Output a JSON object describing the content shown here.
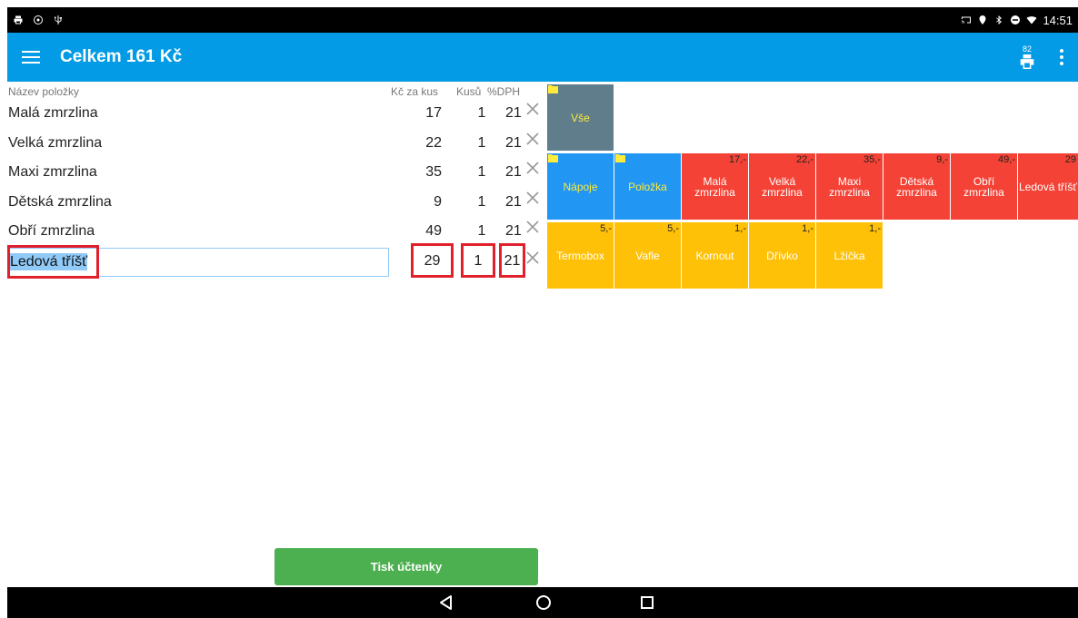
{
  "status_bar": {
    "time": "14:51",
    "left_icons": [
      "print-icon",
      "location-shield-icon",
      "usb-icon"
    ],
    "right_icons": [
      "cast-icon",
      "location-icon",
      "bluetooth-icon",
      "do-not-disturb-icon",
      "wifi-icon"
    ]
  },
  "app_bar": {
    "title": "Celkem 161 Kč",
    "print_badge": "82",
    "background": "#039be5"
  },
  "table": {
    "headers": {
      "name": "Název položky",
      "price": "Kč za kus",
      "qty": "Kusů",
      "vat": "%DPH"
    },
    "rows": [
      {
        "name": "Malá zmrzlina",
        "price": "17",
        "qty": "1",
        "vat": "21"
      },
      {
        "name": "Velká zmrzlina",
        "price": "22",
        "qty": "1",
        "vat": "21"
      },
      {
        "name": "Maxi zmrzlina",
        "price": "35",
        "qty": "1",
        "vat": "21"
      },
      {
        "name": "Dětská zmrzlina",
        "price": "9",
        "qty": "1",
        "vat": "21"
      },
      {
        "name": "Obří zmrzlina",
        "price": "49",
        "qty": "1",
        "vat": "21"
      }
    ],
    "editing": {
      "name": "Ledová tříšť",
      "price": "29",
      "qty": "1",
      "vat": "21"
    }
  },
  "tiles": {
    "all": {
      "label": "Vše",
      "color": "#607d8b"
    },
    "folders": [
      {
        "label": "Nápoje",
        "color": "#2196f3"
      },
      {
        "label": "Položka",
        "color": "#2196f3"
      }
    ],
    "red": [
      {
        "label": "Malá zmrzlina",
        "price": "17,-"
      },
      {
        "label": "Velká zmrzlina",
        "price": "22,-"
      },
      {
        "label": "Maxi zmrzlina",
        "price": "35,-"
      },
      {
        "label": "Dětská zmrzlina",
        "price": "9,-"
      },
      {
        "label": "Obří zmrzlina",
        "price": "49,-"
      },
      {
        "label": "Ledová tříšť",
        "price": "29"
      }
    ],
    "yellow": [
      {
        "label": "Termobox",
        "price": "5,-"
      },
      {
        "label": "Vafle",
        "price": "5,-"
      },
      {
        "label": "Kornout",
        "price": "1,-"
      },
      {
        "label": "Dřívko",
        "price": "1,-"
      },
      {
        "label": "Lžička",
        "price": "1,-"
      }
    ],
    "colors": {
      "red": "#f44336",
      "yellow": "#ffc107",
      "blue": "#2196f3",
      "gray": "#607d8b"
    }
  },
  "footer": {
    "print_button": "Tisk účtenky",
    "print_button_color": "#4caf50"
  },
  "nav_bar": {
    "icons": [
      "back-icon",
      "home-icon",
      "recents-icon"
    ]
  }
}
